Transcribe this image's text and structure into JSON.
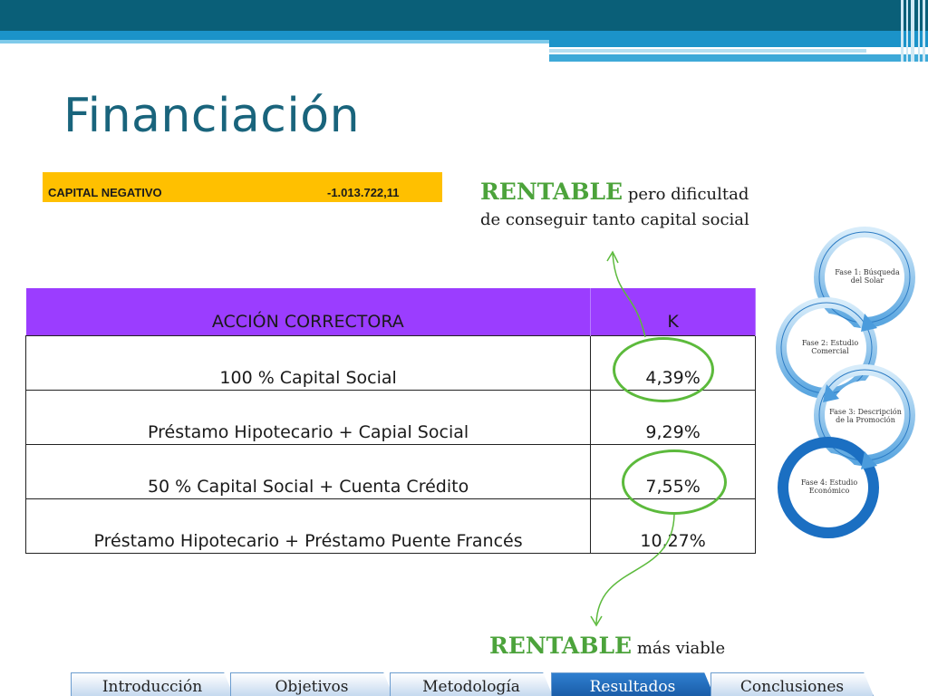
{
  "slide": {
    "title": "Financiación"
  },
  "capital": {
    "label": "CAPITAL NEGATIVO",
    "value": "-1.013.722,11",
    "color": "#ffc000"
  },
  "note_top": {
    "highlight": "RENTABLE",
    "text": " pero dificultad de conseguir tanto capital social"
  },
  "note_bottom": {
    "highlight": "RENTABLE",
    "text": " más viable"
  },
  "table": {
    "headers": [
      "ACCIÓN CORRECTORA",
      "K"
    ],
    "header_color": "#9b3dff",
    "rows": [
      {
        "action": "100 % Capital Social",
        "k": "4,39%"
      },
      {
        "action": "Préstamo Hipotecario + Capial Social",
        "k": "9,29%"
      },
      {
        "action": "50 % Capital Social + Cuenta Crédito",
        "k": "7,55%"
      },
      {
        "action": "Préstamo Hipotecario + Préstamo Puente Francés",
        "k": "10,27%"
      }
    ]
  },
  "diagram": {
    "phases": [
      "Fase 1: Búsqueda del Solar",
      "Fase 2: Estudio Comercial",
      "Fase 3: Descripción de la Promoción",
      "Fase 4: Estudio Económico"
    ],
    "color": "#1b6fc2"
  },
  "nav": {
    "tabs": [
      "Introducción",
      "Objetivos",
      "Metodología",
      "Resultados",
      "Conclusiones"
    ],
    "active": "Resultados"
  }
}
